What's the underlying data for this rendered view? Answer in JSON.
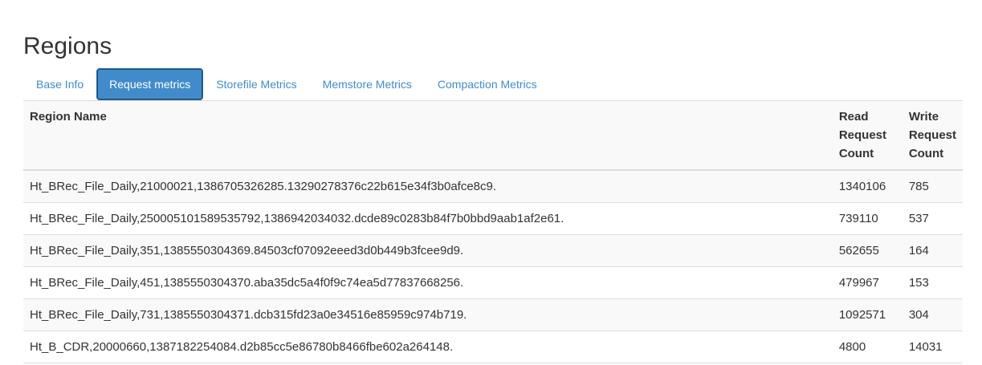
{
  "page": {
    "title": "Regions"
  },
  "tabs": [
    {
      "label": "Base Info",
      "active": false
    },
    {
      "label": "Request metrics",
      "active": true
    },
    {
      "label": "Storefile Metrics",
      "active": false
    },
    {
      "label": "Memstore Metrics",
      "active": false
    },
    {
      "label": "Compaction Metrics",
      "active": false
    }
  ],
  "table": {
    "headers": {
      "region": "Region Name",
      "read_line1": "Read",
      "read_line2": "Request",
      "read_line3": "Count",
      "write_line1": "Write",
      "write_line2": "Request",
      "write_line3": "Count"
    },
    "rows": [
      {
        "region": "Ht_BRec_File_Daily,21000021,1386705326285.13290278376c22b615e34f3b0afce8c9.",
        "read": "1340106",
        "write": "785"
      },
      {
        "region": "Ht_BRec_File_Daily,250005101589535792,1386942034032.dcde89c0283b84f7b0bbd9aab1af2e61.",
        "read": "739110",
        "write": "537"
      },
      {
        "region": "Ht_BRec_File_Daily,351,1385550304369.84503cf07092eeed3d0b449b3fcee9d9.",
        "read": "562655",
        "write": "164"
      },
      {
        "region": "Ht_BRec_File_Daily,451,1385550304370.aba35dc5a4f0f9c74ea5d77837668256.",
        "read": "479967",
        "write": "153"
      },
      {
        "region": "Ht_BRec_File_Daily,731,1385550304371.dcb315fd23a0e34516e85959c974b719.",
        "read": "1092571",
        "write": "304"
      },
      {
        "region": "Ht_B_CDR,20000660,1387182254084.d2b85cc5e86780b8466fbe602a264148.",
        "read": "4800",
        "write": "14031"
      }
    ]
  },
  "colors": {
    "link": "#428bca",
    "active_tab_bg": "#428bca",
    "text": "#333333",
    "border": "#dddddd",
    "stripe": "#f9f9f9"
  }
}
